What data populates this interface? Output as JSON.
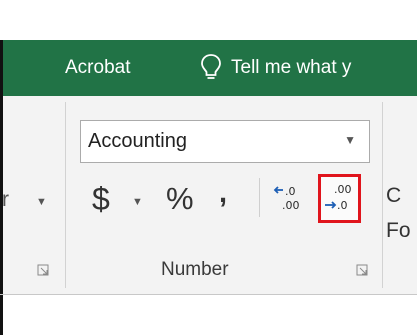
{
  "tabs": {
    "acrobat_label": "Acrobat",
    "tell_me_label": "Tell me what y",
    "tell_me_icon": "lightbulb-icon"
  },
  "number_group": {
    "format_select_value": "Accounting",
    "format_dropdown_icon": "chevron-down-icon",
    "partial_left_label": "r",
    "currency_label": "$",
    "percent_label": "%",
    "comma_label": ",",
    "increase_decimal_icon": "increase-decimal-icon",
    "decrease_decimal_icon": "decrease-decimal-icon",
    "group_label": "Number",
    "dialog_launcher_icon": "dialog-launcher-icon"
  },
  "next_group": {
    "partial_label_top": "C",
    "partial_label_bottom": "Fo"
  },
  "colors": {
    "ribbon_green": "#217346",
    "ribbon_body": "#f3f3f3",
    "highlight_border": "#e0141c",
    "icon_blue": "#1e5fb5"
  }
}
